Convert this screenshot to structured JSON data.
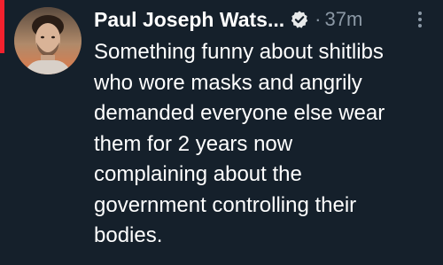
{
  "tweet": {
    "author_name": "Paul Joseph Wats...",
    "separator": "·",
    "time_ago": "37m",
    "text": "Something funny about shitlibs\nwho wore masks and angrily\ndemanded everyone else wear\nthem for 2 years now\ncomplaining about the\ngovernment controlling their\nbodies."
  },
  "colors": {
    "background": "#15202b",
    "text": "#ffffff",
    "secondary_text": "#8b98a5",
    "accent": "#f4212e"
  },
  "icons": {
    "verified": "verified-badge-icon",
    "more": "more-options-icon",
    "avatar": "avatar"
  }
}
